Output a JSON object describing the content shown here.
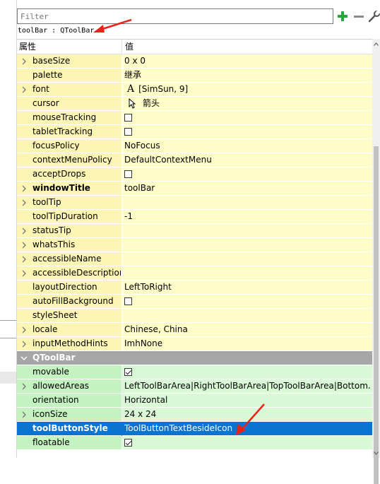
{
  "filter": {
    "placeholder": "Filter"
  },
  "class_label": "toolBar : QToolBar",
  "table": {
    "header": {
      "property": "属性",
      "value": "值"
    },
    "rows": [
      {
        "name": "baseSize",
        "value": "0 x 0",
        "expandable": true
      },
      {
        "name": "palette",
        "value": "继承",
        "expandable": false
      },
      {
        "name": "font",
        "value": "[SimSun, 9]",
        "expandable": true,
        "icon": "font-a-icon",
        "icon_text": "A"
      },
      {
        "name": "cursor",
        "value": "箭头",
        "expandable": false,
        "icon": "cursor-arrow-icon"
      },
      {
        "name": "mouseTracking",
        "value": "",
        "checkbox": false
      },
      {
        "name": "tabletTracking",
        "value": "",
        "checkbox": false
      },
      {
        "name": "focusPolicy",
        "value": "NoFocus"
      },
      {
        "name": "contextMenuPolicy",
        "value": "DefaultContextMenu"
      },
      {
        "name": "acceptDrops",
        "value": "",
        "checkbox": false
      },
      {
        "name": "windowTitle",
        "value": "toolBar",
        "expandable": true,
        "bold": true
      },
      {
        "name": "toolTip",
        "value": "",
        "expandable": true
      },
      {
        "name": "toolTipDuration",
        "value": "-1"
      },
      {
        "name": "statusTip",
        "value": "",
        "expandable": true
      },
      {
        "name": "whatsThis",
        "value": "",
        "expandable": true
      },
      {
        "name": "accessibleName",
        "value": "",
        "expandable": true
      },
      {
        "name": "accessibleDescription",
        "value": "",
        "expandable": true
      },
      {
        "name": "layoutDirection",
        "value": "LeftToRight"
      },
      {
        "name": "autoFillBackground",
        "value": "",
        "checkbox": false
      },
      {
        "name": "styleSheet",
        "value": ""
      },
      {
        "name": "locale",
        "value": "Chinese, China",
        "expandable": true
      },
      {
        "name": "inputMethodHints",
        "value": "ImhNone",
        "expandable": true
      }
    ],
    "category": {
      "name": "QToolBar",
      "expanded": true
    },
    "toolbar_rows": [
      {
        "name": "movable",
        "value": "",
        "checkbox": true
      },
      {
        "name": "allowedAreas",
        "value": "LeftToolBarArea|RightToolBarArea|TopToolBarArea|Bottom...",
        "expandable": true
      },
      {
        "name": "orientation",
        "value": "Horizontal"
      },
      {
        "name": "iconSize",
        "value": "24 x 24",
        "expandable": true
      },
      {
        "name": "toolButtonStyle",
        "value": "ToolButtonTextBesideIcon",
        "bold": true,
        "selected": true
      },
      {
        "name": "floatable",
        "value": "",
        "checkbox": true
      }
    ]
  },
  "colors": {
    "selected": "#0a74d0",
    "yellow_row": "#fefdc8",
    "green_row": "#d9f9d6",
    "category": "#a6a6a6",
    "annotation_arrow": "#e8231a",
    "plus_icon": "#22a83a"
  }
}
